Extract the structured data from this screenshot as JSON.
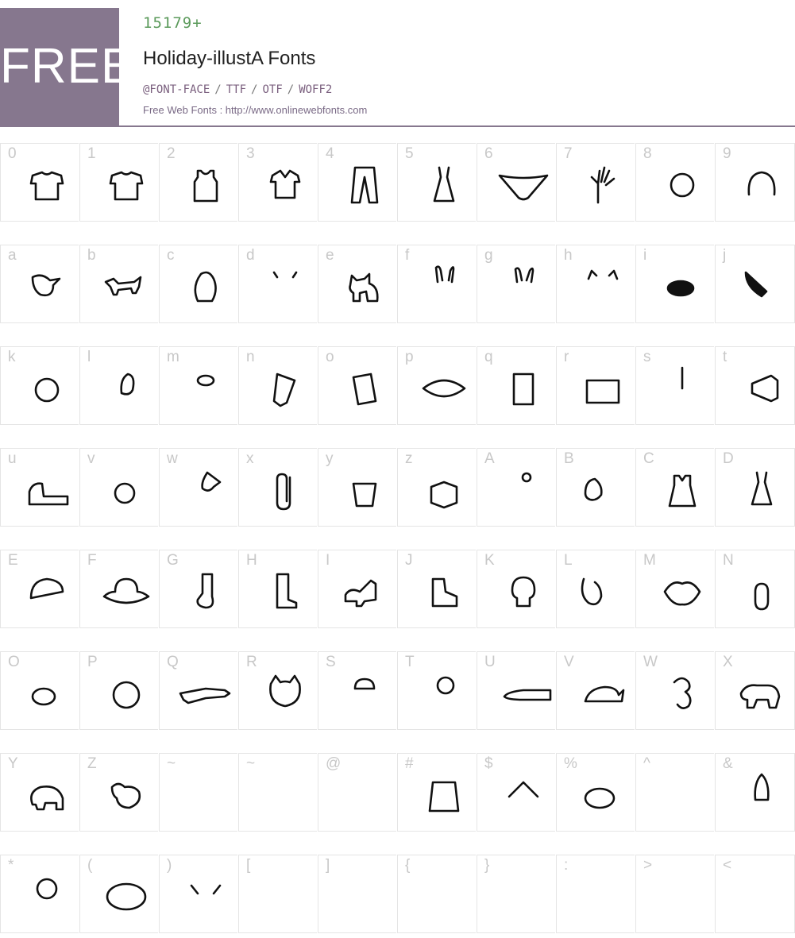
{
  "header": {
    "badge": "FREE",
    "count": "15179+",
    "font_name": "Holiday-illustA Fonts",
    "formats": [
      "@FONT-FACE",
      "TTF",
      "OTF",
      "WOFF2"
    ],
    "separator": "/",
    "site_link": "Free Web Fonts : http://www.onlinewebfonts.com"
  },
  "rows": [
    {
      "cells": [
        {
          "char": "0",
          "icon": "tshirt-m-icon"
        },
        {
          "char": "1",
          "icon": "tshirt-h-icon"
        },
        {
          "char": "2",
          "icon": "striped-tanktop-icon"
        },
        {
          "char": "3",
          "icon": "polo-shirt-icon"
        },
        {
          "char": "4",
          "icon": "jeans-icon"
        },
        {
          "char": "5",
          "icon": "camisole-icon"
        },
        {
          "char": "6",
          "icon": "bikini-bottom-icon"
        },
        {
          "char": "7",
          "icon": "hand-icon"
        },
        {
          "char": "8",
          "icon": "boy-face-icon"
        },
        {
          "char": "9",
          "icon": "girl-face-icon"
        }
      ]
    },
    {
      "cells": [
        {
          "char": "a",
          "icon": "bird-icon"
        },
        {
          "char": "b",
          "icon": "dog-icon"
        },
        {
          "char": "c",
          "icon": "penguin-icon"
        },
        {
          "char": "d",
          "icon": "cow-icon"
        },
        {
          "char": "e",
          "icon": "dog-sitting-icon"
        },
        {
          "char": "f",
          "icon": "rabbit-icon"
        },
        {
          "char": "g",
          "icon": "rabbit-head-icon"
        },
        {
          "char": "h",
          "icon": "pig-icon"
        },
        {
          "char": "i",
          "icon": "bug-icon"
        },
        {
          "char": "j",
          "icon": "knife-icon"
        }
      ]
    },
    {
      "cells": [
        {
          "char": "k",
          "icon": "alarm-clock-icon"
        },
        {
          "char": "l",
          "icon": "chick-icon"
        },
        {
          "char": "m",
          "icon": "stool-icon"
        },
        {
          "char": "n",
          "icon": "pencil-icon"
        },
        {
          "char": "o",
          "icon": "book-icon"
        },
        {
          "char": "p",
          "icon": "eye-icon"
        },
        {
          "char": "q",
          "icon": "computer-icon"
        },
        {
          "char": "r",
          "icon": "camera-icon"
        },
        {
          "char": "s",
          "icon": "guitar-icon"
        },
        {
          "char": "t",
          "icon": "megaphone-icon"
        }
      ]
    },
    {
      "cells": [
        {
          "char": "u",
          "icon": "sneaker-icon"
        },
        {
          "char": "v",
          "icon": "grenade-icon"
        },
        {
          "char": "w",
          "icon": "push-pin-icon"
        },
        {
          "char": "x",
          "icon": "paperclip-icon"
        },
        {
          "char": "y",
          "icon": "bucket-icon"
        },
        {
          "char": "z",
          "icon": "open-box-icon"
        },
        {
          "char": "A",
          "icon": "mermaid-icon"
        },
        {
          "char": "B",
          "icon": "bra-icon"
        },
        {
          "char": "C",
          "icon": "dress-icon"
        },
        {
          "char": "D",
          "icon": "slip-dress-icon"
        }
      ]
    },
    {
      "cells": [
        {
          "char": "E",
          "icon": "cap-icon"
        },
        {
          "char": "F",
          "icon": "hat-icon"
        },
        {
          "char": "G",
          "icon": "sock-icon"
        },
        {
          "char": "H",
          "icon": "boot-icon"
        },
        {
          "char": "I",
          "icon": "high-heel-icon"
        },
        {
          "char": "J",
          "icon": "star-sneaker-icon"
        },
        {
          "char": "K",
          "icon": "skull-icon"
        },
        {
          "char": "L",
          "icon": "bust-icon"
        },
        {
          "char": "M",
          "icon": "lips-icon"
        },
        {
          "char": "N",
          "icon": "mouse-icon"
        }
      ]
    },
    {
      "cells": [
        {
          "char": "O",
          "icon": "turtle-icon"
        },
        {
          "char": "P",
          "icon": "panda-icon"
        },
        {
          "char": "Q",
          "icon": "crocodile-icon"
        },
        {
          "char": "R",
          "icon": "cat-face-icon"
        },
        {
          "char": "S",
          "icon": "jellyfish-icon"
        },
        {
          "char": "T",
          "icon": "octopus-icon"
        },
        {
          "char": "U",
          "icon": "pen-icon"
        },
        {
          "char": "V",
          "icon": "whale-icon"
        },
        {
          "char": "W",
          "icon": "seahorse-icon"
        },
        {
          "char": "X",
          "icon": "puppy-icon"
        }
      ]
    },
    {
      "cells": [
        {
          "char": "Y",
          "icon": "elephant-icon"
        },
        {
          "char": "Z",
          "icon": "chicken-icon"
        },
        {
          "char": "~",
          "icon": ""
        },
        {
          "char": "~",
          "icon": ""
        },
        {
          "char": "@",
          "icon": ""
        },
        {
          "char": "#",
          "icon": "paper-bag-icon"
        },
        {
          "char": "$",
          "icon": "house-icon"
        },
        {
          "char": "%",
          "icon": "record-icon"
        },
        {
          "char": "^",
          "icon": ""
        },
        {
          "char": "&",
          "icon": "rocket-icon"
        }
      ]
    },
    {
      "cells": [
        {
          "char": "*",
          "icon": "balloon-icon"
        },
        {
          "char": "(",
          "icon": "swim-ring-icon"
        },
        {
          "char": ")",
          "icon": "pikachu-icon"
        },
        {
          "char": "[",
          "icon": ""
        },
        {
          "char": "]",
          "icon": ""
        },
        {
          "char": "{",
          "icon": ""
        },
        {
          "char": "}",
          "icon": ""
        },
        {
          "char": ":",
          "icon": ""
        },
        {
          "char": ">",
          "icon": ""
        },
        {
          "char": "<",
          "icon": ""
        }
      ]
    }
  ]
}
